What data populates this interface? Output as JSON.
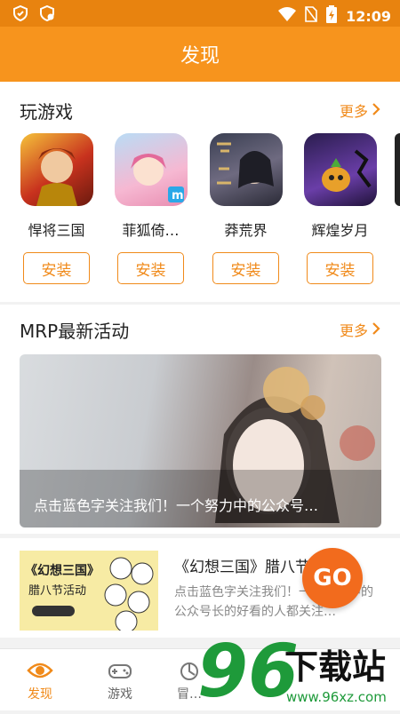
{
  "status_bar": {
    "time": "12:09"
  },
  "header": {
    "title": "发现"
  },
  "games_section": {
    "title": "玩游戏",
    "more_label": "更多",
    "games": [
      {
        "name": "悍将三国",
        "install_label": "安装"
      },
      {
        "name": "菲狐倚…",
        "install_label": "安装"
      },
      {
        "name": "莽荒界",
        "install_label": "安装"
      },
      {
        "name": "辉煌岁月",
        "install_label": "安装"
      }
    ]
  },
  "activity_section": {
    "title": "MRP最新活动",
    "more_label": "更多",
    "banner_caption": "点击蓝色字关注我们！一个努力中的公众号…"
  },
  "article": {
    "title": "《幻想三国》腊八节",
    "description": "点击蓝色字关注我们！一个努力中的公众号长的好看的人都关注…",
    "thumb_text_1": "《幻想三国》",
    "thumb_text_2": "腊八节活动"
  },
  "go_button": {
    "label": "GO"
  },
  "tabs": [
    {
      "label": "发现",
      "icon": "eye-icon"
    },
    {
      "label": "游戏",
      "icon": "gamepad-icon"
    },
    {
      "label": "冒…",
      "icon": "adventure-icon"
    }
  ],
  "watermark": {
    "text": "96下载站",
    "url": "www.96xz.com"
  },
  "colors": {
    "accent": "#f7941d",
    "status_bar": "#e8830f",
    "go": "#f26b1d"
  }
}
